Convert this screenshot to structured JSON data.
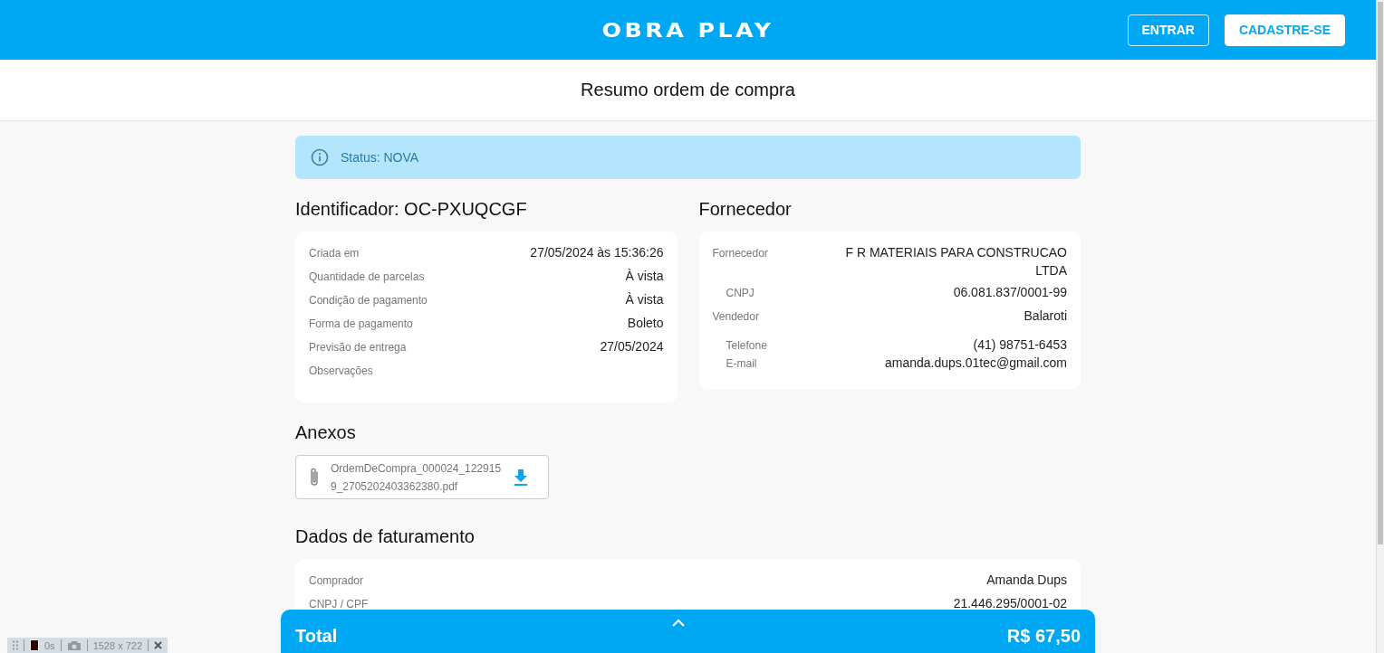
{
  "header": {
    "logo": "OBRA PLAY",
    "buttons": [
      {
        "label": "ENTRAR",
        "kind": "outline"
      },
      {
        "label": "CADASTRE-SE",
        "kind": "filled"
      }
    ]
  },
  "page_title": "Resumo ordem de compra",
  "status": {
    "text": "Status: NOVA"
  },
  "order": {
    "title": "Identificador: OC-PXUQCGF",
    "rows": [
      {
        "label": "Criada em",
        "value": "27/05/2024 às 15:36:26",
        "kind": "main"
      },
      {
        "label": "Quantidade de parcelas",
        "value": "À vista",
        "kind": "main"
      },
      {
        "label": "Condição de pagamento",
        "value": "À vista",
        "kind": "main"
      },
      {
        "label": "Forma de pagamento",
        "value": "Boleto",
        "kind": "main"
      },
      {
        "label": "Previsão de entrega",
        "value": "27/05/2024",
        "kind": "main"
      },
      {
        "label": "Observações",
        "kind": "main"
      }
    ]
  },
  "supplier": {
    "title": "Fornecedor",
    "rows": [
      {
        "label": "Fornecedor",
        "value": "F R MATERIAIS PARA CONSTRUCAO LTDA",
        "kind": "main"
      },
      {
        "label": "CNPJ",
        "value": "06.081.837/0001-99",
        "kind": "sub"
      },
      {
        "label": "Vendedor",
        "value": "Balaroti",
        "kind": "main"
      },
      {
        "label": "Telefone",
        "value": "(41) 98751-6453",
        "kind": "sub"
      },
      {
        "label": "E-mail",
        "value": "amanda.dups.01tec@gmail.com",
        "kind": "sub"
      }
    ]
  },
  "attachments": {
    "title": "Anexos",
    "files": [
      {
        "name": "OrdemDeCompra_000024_1229159_2705202403362380.pdf"
      }
    ]
  },
  "billing": {
    "title": "Dados de faturamento",
    "rows": [
      {
        "label": "Comprador",
        "value": "Amanda Dups",
        "kind": "main"
      },
      {
        "label": "CNPJ / CPF",
        "value": "21.446.295/0001-02",
        "kind": "main"
      }
    ]
  },
  "total": {
    "label": "Total",
    "value": "R$ 67,50"
  },
  "recorder_toolbar": {
    "timer": "0s",
    "size": "1528 x 722"
  }
}
